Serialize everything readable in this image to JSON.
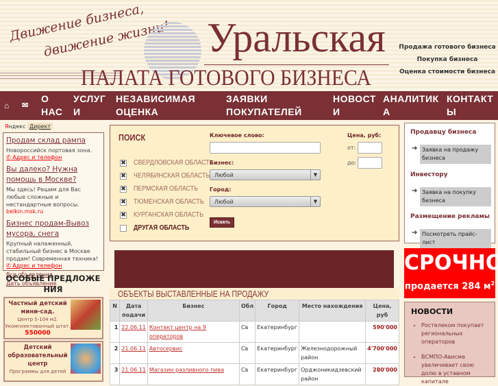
{
  "header": {
    "slogan1": "Движение бизнеса,",
    "slogan2": "движение жизни!",
    "brand_main": "Уральская",
    "brand_sub": "ПАЛАТА ГОТОВОГО БИЗНЕСА",
    "links": [
      "Продажа готового бизнеса",
      "Покупка бизнеса",
      "Оценка стоимости бизнеса"
    ]
  },
  "nav": {
    "items": [
      {
        "l1": "О",
        "l2": "НАС"
      },
      {
        "l1": "УСЛУГ",
        "l2": "И"
      },
      {
        "l1": "НЕЗАВИСИМАЯ",
        "l2": "ОЦЕНКА"
      },
      {
        "l1": "ЗАЯВКИ",
        "l2": "ПОКУПАТЕЛЕЙ"
      },
      {
        "l1": "НОВОСТ",
        "l2": "И"
      },
      {
        "l1": "АНАЛИТИК",
        "l2": "А"
      },
      {
        "l1": "КОНТАКТ",
        "l2": "Ы"
      }
    ]
  },
  "ads": {
    "yandex": "Яндекс",
    "direct": "Директ",
    "items": [
      {
        "title": "Продам склад рампа",
        "text": "Новороссийск портовая зона.",
        "link": "Адрес и телефон"
      },
      {
        "title": "Вы далеко? Нужна помощь в Москве?",
        "text": "Мы здесь! Решим для Вас любые сложные и нестандартные вопросы.",
        "link": "belkin.msk.ru"
      },
      {
        "title": "Бизнес продам-Вывоз мусора, снега",
        "text": "Крупный налаженный, стабильный бизнес в Москве продам! Современная техника!",
        "link": "Адрес и телефон"
      }
    ],
    "all": "Все объявления",
    "give": "Дать объявление"
  },
  "special": {
    "title": "ОСОБЫЕ ПРЕДЛОЖЕНИЯ",
    "offers": [
      {
        "title": "Частный детский мини-сад.",
        "text": "Центр S-104 м2. Укомплектованный штат.",
        "price": "550000"
      },
      {
        "title": "Детский образовательный центр",
        "text": "Программы для детей"
      }
    ]
  },
  "search": {
    "title": "ПОИСК",
    "regions": [
      {
        "name": "СВЕРДЛОВСКАЯ ОБЛАСТЬ",
        "checked": true
      },
      {
        "name": "ЧЕЛЯБИНСКАЯ ОБЛАСТЬ",
        "checked": true
      },
      {
        "name": "ПЕРМСКАЯ ОБЛАСТЬ",
        "checked": true
      },
      {
        "name": "ТЮМЕНСКАЯ ОБЛАСТЬ",
        "checked": true
      },
      {
        "name": "КУРГАНСКАЯ ОБЛАСТЬ",
        "checked": true
      },
      {
        "name": "ДРУГАЯ ОБЛАСТЬ",
        "checked": false
      }
    ],
    "keyword_label": "Ключевое слово:",
    "keyword": "",
    "business_label": "Бизнес:",
    "business": "Любой",
    "city_label": "Город:",
    "city": "Любой",
    "price_label": "Цена, руб:",
    "from_label": "от:",
    "to_label": "до:",
    "button": "Искать"
  },
  "objects": {
    "title": "ОБЪЕКТЫ ВЫСТАВЛЕННЫЕ НА ПРОДАЖУ",
    "columns": [
      "N",
      "Дата подачи",
      "Бизнес",
      "Обл",
      "Город",
      "Место нахождения",
      "Цена, руб"
    ],
    "rows": [
      [
        "1",
        "22.06.11",
        "Контакт центр на 9 операторов",
        "Св",
        "Екатеринбург",
        "",
        "590'000"
      ],
      [
        "2",
        "21.06.11",
        "Автосервис",
        "Св",
        "Екатеринбург",
        "Железнодорожный район",
        "4'700'000"
      ],
      [
        "3",
        "21.06.11",
        "Магазин разливного пива",
        "Св",
        "Екатеринбург",
        "Орджоникидзевский район",
        "280'000"
      ]
    ]
  },
  "right": {
    "sections": [
      {
        "title": "Продавцу бизнеса",
        "link": "Заявка на продажу бизнеса"
      },
      {
        "title": "Инвестору",
        "link": "Заявка на покупку бизнеса"
      },
      {
        "title": "Размещение рекламы",
        "link": "Посмотреть прайс-лист"
      }
    ]
  },
  "urgent": {
    "title": "СРОЧНО",
    "text": "продается 284 м",
    "sup": "2"
  },
  "news": {
    "title": "НОВОСТИ",
    "items": [
      "Ростелеком покупает региональных операторов",
      "ВСМПО-Ависма увеличивает свою долю в уставном капитале"
    ]
  }
}
